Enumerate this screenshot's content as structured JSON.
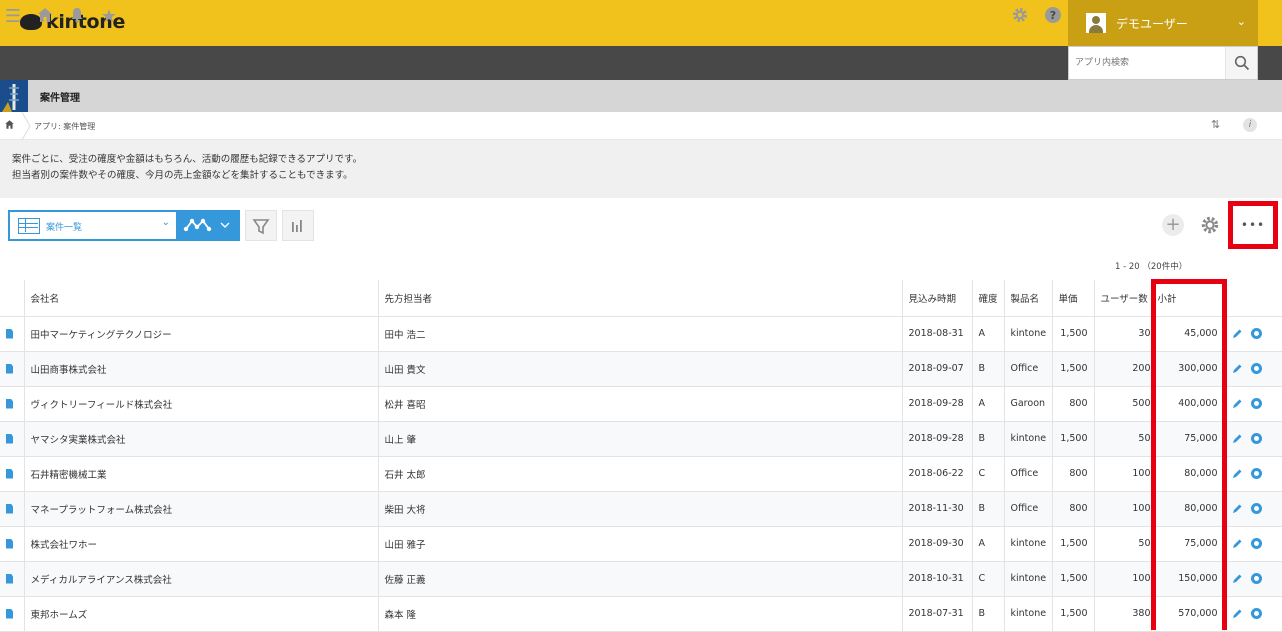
{
  "brand": {
    "name": "kintone"
  },
  "user": {
    "name": "デモユーザー"
  },
  "search": {
    "placeholder": "アプリ内検索"
  },
  "app": {
    "title": "案件管理"
  },
  "breadcrumb": {
    "text": "アプリ: 案件管理"
  },
  "description": {
    "line1": "案件ごとに、受注の確度や金額はもちろん、活動の履歴も記録できるアプリです。",
    "line2": "担当者別の案件数やその確度、今月の売上金額などを集計することもできます。"
  },
  "view": {
    "selected": "案件一覧"
  },
  "pagination": {
    "text": "1 - 20 （20件中）"
  },
  "table": {
    "headers": {
      "company": "会社名",
      "contact": "先方担当者",
      "date": "見込み時期",
      "certainty": "確度",
      "product": "製品名",
      "price": "単価",
      "users": "ユーザー数",
      "subtotal": "小計"
    },
    "rows": [
      {
        "company": "田中マーケティングテクノロジー",
        "contact": "田中 浩二",
        "date": "2018-08-31",
        "certainty": "A",
        "product": "kintone",
        "price": "1,500",
        "users": "30",
        "subtotal": "45,000"
      },
      {
        "company": "山田商事株式会社",
        "contact": "山田 貴文",
        "date": "2018-09-07",
        "certainty": "B",
        "product": "Office",
        "price": "1,500",
        "users": "200",
        "subtotal": "300,000"
      },
      {
        "company": "ヴィクトリーフィールド株式会社",
        "contact": "松井 喜昭",
        "date": "2018-09-28",
        "certainty": "A",
        "product": "Garoon",
        "price": "800",
        "users": "500",
        "subtotal": "400,000"
      },
      {
        "company": "ヤマシタ実業株式会社",
        "contact": "山上 肇",
        "date": "2018-09-28",
        "certainty": "B",
        "product": "kintone",
        "price": "1,500",
        "users": "50",
        "subtotal": "75,000"
      },
      {
        "company": "石井精密機械工業",
        "contact": "石井 太郎",
        "date": "2018-06-22",
        "certainty": "C",
        "product": "Office",
        "price": "800",
        "users": "100",
        "subtotal": "80,000"
      },
      {
        "company": "マネープラットフォーム株式会社",
        "contact": "柴田 大将",
        "date": "2018-11-30",
        "certainty": "B",
        "product": "Office",
        "price": "800",
        "users": "100",
        "subtotal": "80,000"
      },
      {
        "company": "株式会社ワホー",
        "contact": "山田 雅子",
        "date": "2018-09-30",
        "certainty": "A",
        "product": "kintone",
        "price": "1,500",
        "users": "50",
        "subtotal": "75,000"
      },
      {
        "company": "メディカルアライアンス株式会社",
        "contact": "佐藤 正義",
        "date": "2018-10-31",
        "certainty": "C",
        "product": "kintone",
        "price": "1,500",
        "users": "100",
        "subtotal": "150,000"
      },
      {
        "company": "東邦ホームズ",
        "contact": "森本 隆",
        "date": "2018-07-31",
        "certainty": "B",
        "product": "kintone",
        "price": "1,500",
        "users": "380",
        "subtotal": "570,000"
      }
    ]
  },
  "colors": {
    "topbar": "#f0c21b",
    "navbar": "#484848",
    "accent": "#3498db",
    "highlight": "#e60012"
  },
  "icons": {
    "menu": "hamburger-icon",
    "home": "home-icon",
    "notification": "bell-icon",
    "favorite": "star-icon",
    "settings": "gear-icon",
    "help": "help-icon",
    "search": "search-icon",
    "record": "document-icon",
    "edit": "pencil-icon",
    "delete": "remove-icon"
  }
}
